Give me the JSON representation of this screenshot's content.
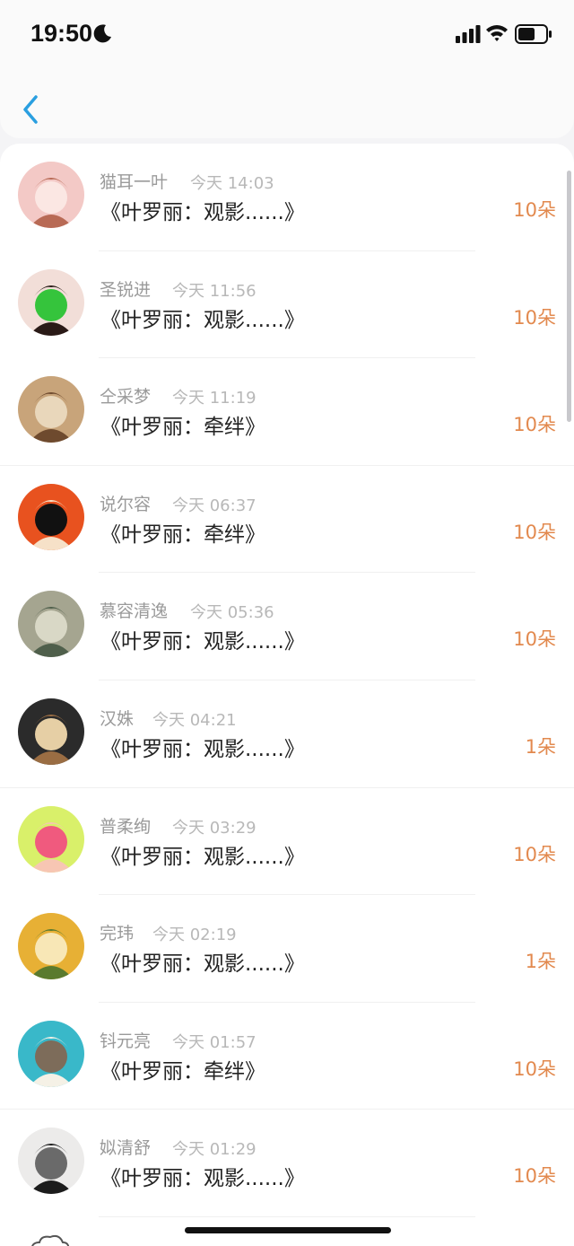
{
  "status_bar": {
    "time": "19:50"
  },
  "items": [
    {
      "name": "猫耳一叶",
      "time": "今天 14:03",
      "title": "《叶罗丽：观影......》",
      "flowers": "10朵",
      "avatar_icon": "anime-girl-avatar-icon",
      "avatar_colors": [
        "#f3c9c6",
        "#b86a55",
        "#fbe7e3"
      ]
    },
    {
      "name": "圣锐进",
      "time": "今天 11:56",
      "title": "《叶罗丽：观影......》",
      "flowers": "10朵",
      "avatar_icon": "girl-portrait-avatar-icon",
      "avatar_colors": [
        "#f2ded8",
        "#2a1a17",
        "#35c43c"
      ]
    },
    {
      "name": "仝采梦",
      "time": "今天 11:19",
      "title": "《叶罗丽：牵绊》",
      "flowers": "10朵",
      "avatar_icon": "tower-avatar-icon",
      "avatar_colors": [
        "#c8a47a",
        "#6e4a2e",
        "#e9d7bb"
      ]
    },
    {
      "name": "说尔容",
      "time": "今天 06:37",
      "title": "《叶罗丽：牵绊》",
      "flowers": "10朵",
      "avatar_icon": "red-hat-girl-avatar-icon",
      "avatar_colors": [
        "#e8521f",
        "#f6e1c8",
        "#111111"
      ]
    },
    {
      "name": "慕容清逸",
      "time": "今天 05:36",
      "title": "《叶罗丽：观影......》",
      "flowers": "10朵",
      "avatar_icon": "woman-reading-avatar-icon",
      "avatar_colors": [
        "#a5a590",
        "#4f5f4b",
        "#d9d8c6"
      ]
    },
    {
      "name": "汉姝",
      "time": "今天 04:21",
      "title": "《叶罗丽：观影......》",
      "flowers": "1朵",
      "avatar_icon": "chipmunk-avatar-icon",
      "avatar_colors": [
        "#2b2b2b",
        "#9a6d43",
        "#e6cfa5"
      ]
    },
    {
      "name": "普柔绚",
      "time": "今天 03:29",
      "title": "《叶罗丽：观影......》",
      "flowers": "10朵",
      "avatar_icon": "smiling-cartoon-avatar-icon",
      "avatar_colors": [
        "#d9f06a",
        "#f7c6b3",
        "#f05a7e"
      ]
    },
    {
      "name": "完玮",
      "time": "今天 02:19",
      "title": "《叶罗丽：观影......》",
      "flowers": "1朵",
      "avatar_icon": "anime-boy-avatar-icon",
      "avatar_colors": [
        "#e7b035",
        "#5a7a2e",
        "#f8e7b6"
      ]
    },
    {
      "name": "钭元亮",
      "time": "今天 01:57",
      "title": "《叶罗丽：牵绊》",
      "flowers": "10朵",
      "avatar_icon": "alpaca-avatar-icon",
      "avatar_colors": [
        "#39b8c9",
        "#f5f1e6",
        "#7d6c5a"
      ]
    },
    {
      "name": "姒清舒",
      "time": "今天 01:29",
      "title": "《叶罗丽：观影......》",
      "flowers": "10朵",
      "avatar_icon": "sunglasses-girl-avatar-icon",
      "avatar_colors": [
        "#ecebea",
        "#1c1c1c",
        "#6a6a6a"
      ]
    }
  ]
}
